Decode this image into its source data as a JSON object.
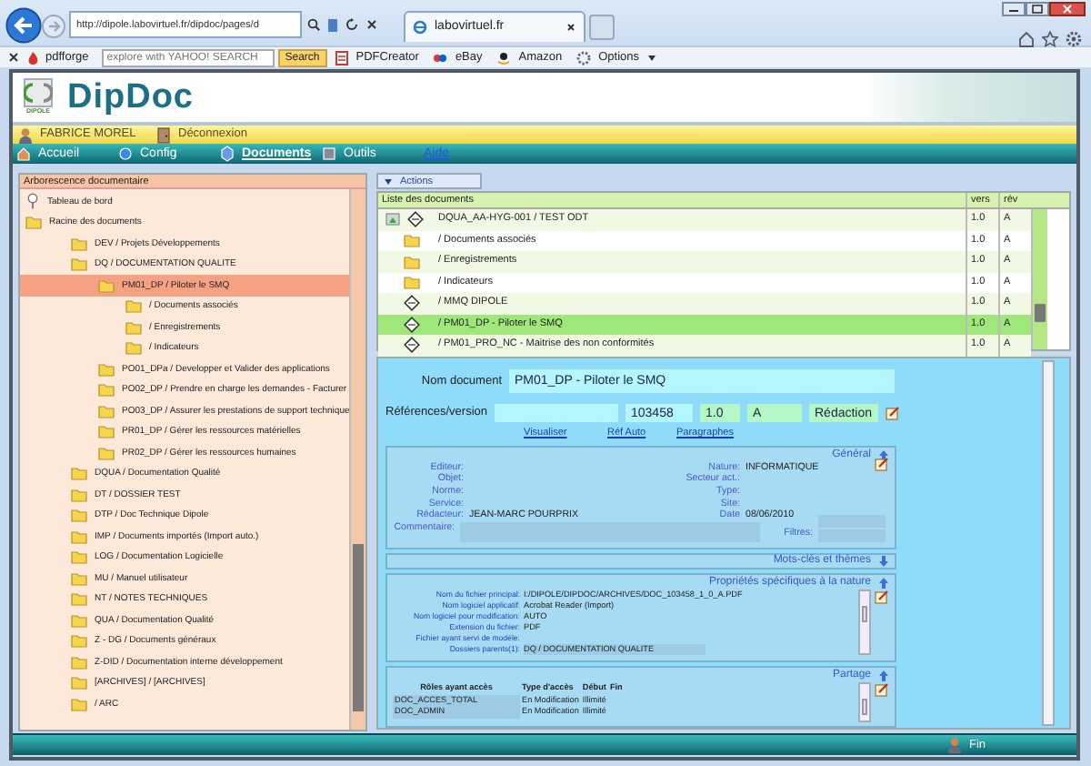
{
  "browser": {
    "address": "http://dipole.labovirtuel.fr/dipdoc/pages/d",
    "tabs": [
      {
        "label": "labovirtuel.fr",
        "selected": true
      }
    ],
    "toolbar": {
      "brand": "pdfforge",
      "search_placeholder": "explore with YAHOO! SEARCH",
      "search_button": "Search",
      "items": [
        {
          "label": "PDFCreator",
          "kind": "pdf"
        },
        {
          "label": "eBay",
          "kind": "ebay"
        },
        {
          "label": "Amazon",
          "kind": "amazon"
        },
        {
          "label": "Options",
          "kind": "options"
        }
      ]
    }
  },
  "app": {
    "logo_caption": "DIPOLE",
    "title": "DipDoc",
    "user": "FABRICE MOREL",
    "logout": "Déconnexion",
    "menu": [
      {
        "label": "Accueil",
        "kind": "home",
        "selected": false
      },
      {
        "label": "Config",
        "kind": "config",
        "selected": false
      },
      {
        "label": "Documents",
        "kind": "documents",
        "selected": true
      },
      {
        "label": "Outils",
        "kind": "tools",
        "selected": false
      },
      {
        "label": "Aide",
        "kind": "link",
        "selected": false
      }
    ]
  },
  "tree": {
    "title": "Arborescence documentaire",
    "items": [
      {
        "label": "Tableau de bord",
        "kind": "pin",
        "selected": false
      },
      {
        "label": "Racine des documents",
        "kind": "folder",
        "selected": false,
        "children": [
          {
            "label": "DEV / Projets Développements",
            "kind": "folder",
            "selected": false
          },
          {
            "label": "DQ / DOCUMENTATION QUALITE",
            "kind": "folder",
            "selected": false,
            "children": [
              {
                "label": "PM01_DP / Piloter le SMQ",
                "kind": "folder",
                "selected": true,
                "children": [
                  {
                    "label": "/ Documents associés",
                    "kind": "folder",
                    "selected": false
                  },
                  {
                    "label": "/ Enregistrements",
                    "kind": "folder",
                    "selected": false
                  },
                  {
                    "label": "/ Indicateurs",
                    "kind": "folder",
                    "selected": false
                  }
                ]
              },
              {
                "label": "PO01_DPa / Developper et Valider des applications",
                "kind": "folder",
                "selected": false
              },
              {
                "label": "PO02_DP / Prendre en charge les demandes - Facturer",
                "kind": "folder",
                "selected": false
              },
              {
                "label": "PO03_DP / Assurer les prestations de support technique",
                "kind": "folder",
                "selected": false
              },
              {
                "label": "PR01_DP / Gérer les ressources matérielles",
                "kind": "folder",
                "selected": false
              },
              {
                "label": "PR02_DP / Gérer les ressources humaines",
                "kind": "folder",
                "selected": false
              }
            ]
          },
          {
            "label": "DQUA / Documentation Qualité",
            "kind": "folder",
            "selected": false
          },
          {
            "label": "DT / DOSSIER TEST",
            "kind": "folder",
            "selected": false
          },
          {
            "label": "DTP / Doc Technique Dipole",
            "kind": "folder",
            "selected": false
          },
          {
            "label": "IMP / Documents importés (Import auto.)",
            "kind": "folder",
            "selected": false
          },
          {
            "label": "LOG / Documentation Logicielle",
            "kind": "folder",
            "selected": false
          },
          {
            "label": "MU / Manuel utilisateur",
            "kind": "folder",
            "selected": false
          },
          {
            "label": "NT / NOTES TECHNIQUES",
            "kind": "folder",
            "selected": false
          },
          {
            "label": "QUA / Documentation Qualité",
            "kind": "folder",
            "selected": false
          },
          {
            "label": "Z - DG / Documents généraux",
            "kind": "folder",
            "selected": false
          },
          {
            "label": "Z-DID / Documentation interne développement",
            "kind": "folder",
            "selected": false
          },
          {
            "label": "[ARCHIVES] / [ARCHIVES]",
            "kind": "folder",
            "selected": false
          },
          {
            "label": "/ ARC",
            "kind": "folder",
            "selected": false
          }
        ]
      }
    ]
  },
  "actions_tab": "Actions",
  "documents": {
    "columns": [
      "Liste des documents",
      "vers",
      "rév"
    ],
    "rows": [
      {
        "name": "DQUA_AA-HYG-001 / TEST ODT",
        "kind": "document",
        "version": "1.0",
        "revision": "A",
        "selected": false,
        "children": [
          {
            "name": "/ Documents associés",
            "kind": "folder",
            "version": "1.0",
            "revision": "A",
            "selected": false
          },
          {
            "name": "/ Enregistrements",
            "kind": "folder",
            "version": "1.0",
            "revision": "A",
            "selected": false
          },
          {
            "name": "/ Indicateurs",
            "kind": "folder",
            "version": "1.0",
            "revision": "A",
            "selected": false
          },
          {
            "name": "/ MMQ DIPOLE",
            "kind": "document",
            "version": "1.0",
            "revision": "A",
            "selected": false
          },
          {
            "name": "/ PM01_DP - Piloter le SMQ",
            "kind": "document",
            "version": "1.0",
            "revision": "A",
            "selected": true
          },
          {
            "name": "/ PM01_PRO_NC - Maitrise des non conformités",
            "kind": "document",
            "version": "1.0",
            "revision": "A",
            "selected": false
          }
        ]
      }
    ]
  },
  "detail": {
    "name": {
      "label": "Nom document",
      "value": "PM01_DP - Piloter le SMQ"
    },
    "reference": {
      "label": "Références/version",
      "number": "103458",
      "version": "1.0",
      "revision": "A",
      "status": "Rédaction"
    },
    "links": [
      "Visualiser",
      "Réf Auto",
      "Paragraphes"
    ],
    "general": {
      "title": "Général",
      "fields_left": [
        {
          "label": "Editeur:"
        },
        {
          "label": "Objet:"
        },
        {
          "label": "Norme:"
        },
        {
          "label": "Service:"
        },
        {
          "label": "Rédacteur:",
          "value": "JEAN-MARC POURPRIX"
        }
      ],
      "fields_right": [
        {
          "label": "Nature:",
          "value": "INFORMATIQUE"
        },
        {
          "label": "Secteur act.:"
        },
        {
          "label": "Type:"
        },
        {
          "label": "Site:"
        },
        {
          "label": "Date",
          "value": "08/06/2010"
        }
      ],
      "comment_label": "Commentaire:",
      "filters_label": "Filtres:"
    },
    "keywords_title": "Mots-clés et thèmes",
    "properties": {
      "title": "Propriétés spécifiques à la nature",
      "rows": [
        {
          "label": "Nom du fichier principal:",
          "value": "I:/DIPOLE/DIPDOC/ARCHIVES/DOC_103458_1_0_A.PDF"
        },
        {
          "label": "Nom logiciel applicatif:",
          "value": "Acrobat Reader (Import)"
        },
        {
          "label": "Nom logiciel pour modification:",
          "value": "AUTO"
        },
        {
          "label": "Extension du fichier:",
          "value": "PDF"
        },
        {
          "label": "Fichier ayant servi de modèle:"
        },
        {
          "label": "Dossiers parents(1):",
          "value": "DQ / DOCUMENTATION QUALITE"
        }
      ]
    },
    "sharing": {
      "title": "Partage",
      "columns": [
        "Rôles ayant accès",
        "Type d'accès",
        "Début",
        "Fin"
      ],
      "rows": [
        [
          "DOC_ACCES_TOTAL",
          "En Modification",
          "Illimité"
        ],
        [
          "DOC_ADMIN",
          "En Modification",
          "Illimité"
        ]
      ]
    }
  },
  "footer": {
    "label": "Fin"
  }
}
